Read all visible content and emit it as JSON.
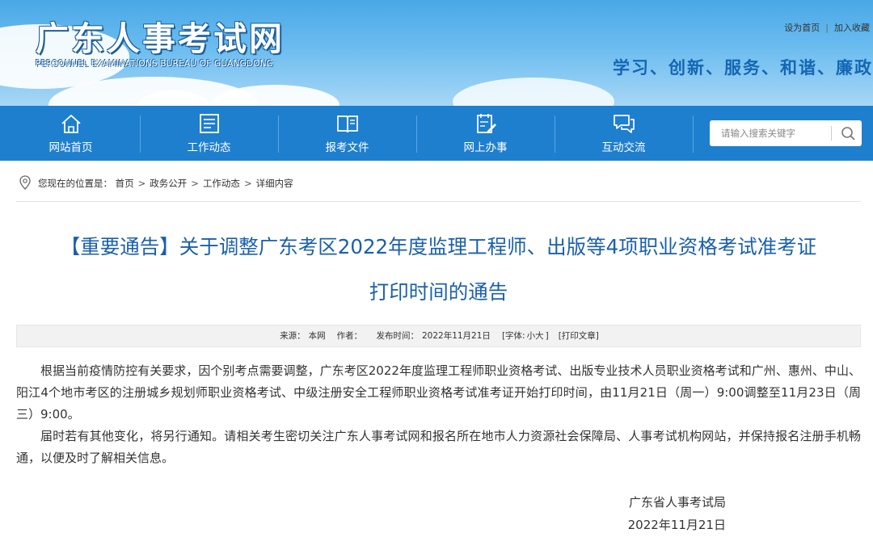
{
  "header": {
    "site_title": "广东人事考试网",
    "site_subtitle": "PERSONNEL EXAMINATIONS BUREAU OF GUANGDONG",
    "top_links": {
      "set_home": "设为首页",
      "separator": "|",
      "bookmark": "加入收藏"
    },
    "slogan": "学习、创新、服务、和谐、廉政"
  },
  "nav": {
    "items": [
      {
        "label": "网站首页",
        "icon": "home-icon"
      },
      {
        "label": "工作动态",
        "icon": "list-board-icon"
      },
      {
        "label": "报考文件",
        "icon": "open-book-icon"
      },
      {
        "label": "网上办事",
        "icon": "clipboard-pen-icon"
      },
      {
        "label": "互动交流",
        "icon": "chat-bubbles-icon"
      }
    ],
    "search": {
      "placeholder": "请输入搜索关键字",
      "icon": "search-icon"
    },
    "colors": {
      "bar": "#1e7fce",
      "text": "#ffffff"
    }
  },
  "breadcrumb": {
    "prefix": "您现在的位置是：",
    "items": [
      "首页",
      "政务公开",
      "工作动态",
      "详细内容"
    ],
    "separator": ">",
    "icon": "location-pin-icon"
  },
  "article": {
    "title_line1": "【重要通告】关于调整广东考区2022年度监理工程师、出版等4项职业资格考试准考证",
    "title_line2": "打印时间的通告",
    "title_color": "#1a60aa",
    "meta": {
      "source_label": "来源：",
      "source": "本网",
      "author_label": "作者：",
      "date_label": "发布时间：",
      "date": "2022年11月21日",
      "font_label": "[字体:",
      "font_small": "小",
      "font_large": "大",
      "font_close": "]",
      "print": "[打印文章]"
    },
    "paragraphs": [
      "根据当前疫情防控有关要求，因个别考点需要调整，广东考区2022年度监理工程师职业资格考试、出版专业技术人员职业资格考试和广州、惠州、中山、阳江4个地市考区的注册城乡规划师职业资格考试、中级注册安全工程师职业资格考试准考证开始打印时间，由11月21日（周一）9:00调整至11月23日（周三）9:00。",
      "届时若有其他变化，将另行通知。请相关考生密切关注广东人事考试网和报名所在地市人力资源社会保障局、人事考试机构网站，并保持报名注册手机畅通，以便及时了解相关信息。"
    ],
    "signature": {
      "org": "广东省人事考试局",
      "date": "2022年11月21日"
    }
  }
}
